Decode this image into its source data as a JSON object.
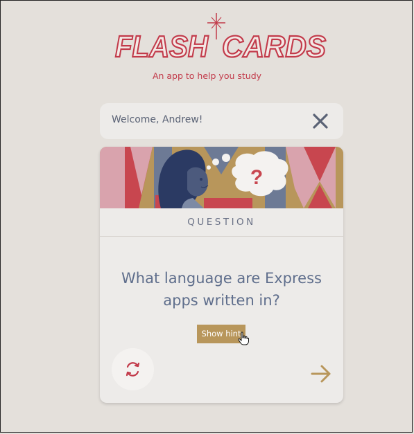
{
  "app": {
    "title_left": "FLASH",
    "title_right": "CARDS",
    "tagline": "An app to help you study"
  },
  "welcome": {
    "message": "Welcome, Andrew!",
    "close_icon": "close-x-icon"
  },
  "card": {
    "label": "QUESTION",
    "question": "What language are Express apps written in?",
    "hint_button": "Show hint",
    "banner_thought": "?",
    "flip_icon": "flip-cycle-icon",
    "next_icon": "arrow-right-icon"
  },
  "colors": {
    "brand_red": "#c23a4a",
    "gold": "#b8965b",
    "navy": "#2b3a63",
    "slate": "#6a7186",
    "pink": "#d9a3ad",
    "background": "#e4e0db"
  }
}
